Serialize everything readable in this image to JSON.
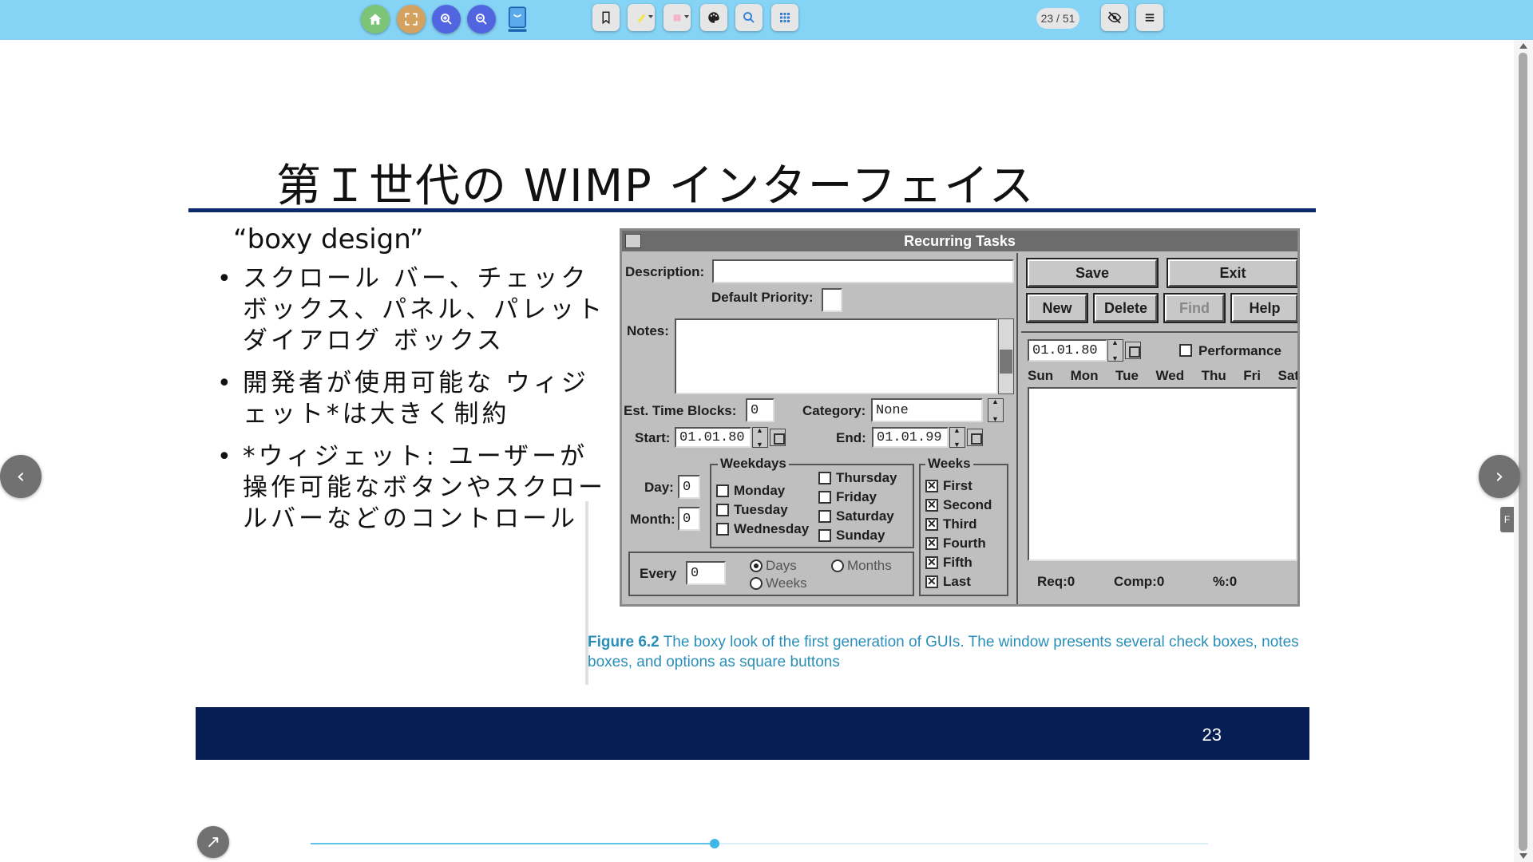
{
  "toolbar": {
    "buttons": [
      {
        "name": "home-button",
        "icon": "home-icon",
        "color": "#7cc576"
      },
      {
        "name": "fullscreen-button",
        "icon": "fullscreen-icon",
        "color": "#d4a15e"
      },
      {
        "name": "zoom-in-button",
        "icon": "zoom-in-icon",
        "color": "#5165e0"
      },
      {
        "name": "zoom-out-button",
        "icon": "zoom-out-icon",
        "color": "#5165e0"
      },
      {
        "name": "app-logo",
        "icon": "book-logo-icon",
        "color": "#3a8fd8"
      },
      {
        "name": "bookmark-button",
        "icon": "bookmark-icon"
      },
      {
        "name": "highlighter-button",
        "icon": "highlighter-icon",
        "color": "#f6e34d"
      },
      {
        "name": "eraser-button",
        "icon": "eraser-icon",
        "color": "#f2b6c6"
      },
      {
        "name": "palette-button",
        "icon": "palette-icon"
      },
      {
        "name": "search-button",
        "icon": "search-icon",
        "color": "#2e7fd6"
      },
      {
        "name": "grid-button",
        "icon": "grid-icon",
        "color": "#2e7fd6"
      }
    ],
    "page_indicator": "23 / 51",
    "hide_button_icon": "eye-off-icon",
    "menu_button_icon": "menu-icon",
    "bar_color": "#85d3f5"
  },
  "slide": {
    "title": "第Ｉ世代の WIMP インターフェイス",
    "subtitle": "“boxy design”",
    "bullets": [
      "スクロール バー、チェック ボックス、パネル、パレット ダイアログ ボックス",
      "開発者が使用可能な ウィジェット*は大きく制約",
      "*ウィジェット: ユーザーが操作可能なボタンやスクロールバーなどのコントロール"
    ],
    "figure": {
      "window_title": "Recurring Tasks",
      "labels": {
        "description": "Description:",
        "default_priority": "Default Priority:",
        "notes": "Notes:",
        "est_time_blocks": "Est. Time Blocks:",
        "category": "Category:",
        "start": "Start:",
        "end": "End:",
        "day": "Day:",
        "month": "Month:",
        "every": "Every",
        "weekdays": "Weekdays",
        "weeks": "Weeks",
        "performance": "Performance"
      },
      "values": {
        "est_time_blocks": "0",
        "category": "None",
        "start_date": "01.01.80",
        "end_date": "01.01.99",
        "day": "0",
        "month": "0",
        "every": "0",
        "perf_date": "01.01.80"
      },
      "buttons": [
        "Save",
        "Exit",
        "New",
        "Delete",
        "Find",
        "Help"
      ],
      "weekdays_left": [
        "Monday",
        "Tuesday",
        "Wednesday"
      ],
      "weekdays_right": [
        "Thursday",
        "Friday",
        "Saturday",
        "Sunday"
      ],
      "weeks": [
        "First",
        "Second",
        "Third",
        "Fourth",
        "Fifth",
        "Last"
      ],
      "every_options": [
        "Days",
        "Months",
        "Weeks"
      ],
      "day_headers": [
        "Sun",
        "Mon",
        "Tue",
        "Wed",
        "Thu",
        "Fri",
        "Sat"
      ],
      "stats": [
        "Req:0",
        "Comp:0",
        "%:0"
      ]
    },
    "caption_label": "Figure 6.2",
    "caption_text": "The boxy look of the first generation of GUIs. The window presents several check boxes, notes boxes, and options as square buttons",
    "page_number": "23",
    "footer_color": "#071e55",
    "rule_color": "#0d2a6c"
  },
  "navigation": {
    "prev_icon": "chevron-left-icon",
    "next_icon": "chevron-right-icon",
    "side_tab_label": "F",
    "share_icon": "share-arrow-icon",
    "progress_fraction": 0.45
  }
}
